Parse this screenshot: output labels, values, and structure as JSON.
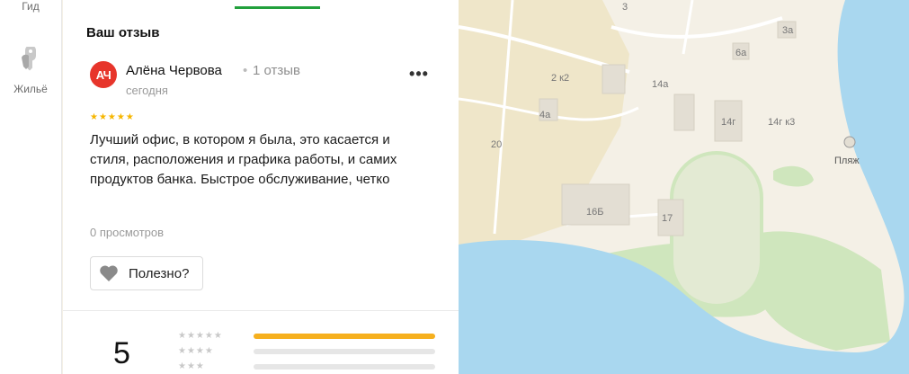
{
  "rail": {
    "guide_label": "Гид",
    "housing_label": "Жильё"
  },
  "review": {
    "section_title": "Ваш отзыв",
    "avatar_initials": "АЧ",
    "author": "Алёна Червова",
    "separator": "•",
    "review_count": "1 отзыв",
    "date": "сегодня",
    "more_label": "•••",
    "rating_stars": "★★★★★",
    "text": "Лучший офис, в котором я была, это касается и стиля, расположения и графика работы, и самих продуктов банка. Быстрое обслуживание, четко",
    "views": "0 просмотров",
    "useful_label": "Полезно?"
  },
  "rating_summary": {
    "value": "5",
    "rows": [
      {
        "stars": "★★★★★",
        "fill": 1.0,
        "color": "#f6b01e"
      },
      {
        "stars": "★★★★",
        "fill": 0.0,
        "color": "#f6b01e"
      },
      {
        "stars": "★★★",
        "fill": 0.0,
        "color": "#f6b01e"
      }
    ]
  },
  "map": {
    "labels": [
      "3",
      "3а",
      "6а",
      "2 к2",
      "14а",
      "4а",
      "14г",
      "14г к3",
      "20",
      "16Б",
      "17",
      "Пляж"
    ],
    "colors": {
      "land": "#f4f0e6",
      "water": "#a9d7ef",
      "green": "#cfe6bd",
      "building": "#e3ded3",
      "road": "#ffffff"
    }
  }
}
